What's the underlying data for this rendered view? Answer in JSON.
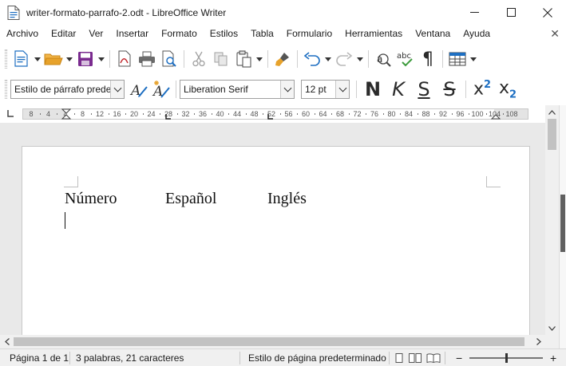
{
  "window": {
    "title": "writer-formato-parrafo-2.odt - LibreOffice Writer",
    "minimize_label": "—",
    "maximize_label": "☐",
    "close_label": "✕"
  },
  "menu": {
    "items": [
      "Archivo",
      "Editar",
      "Ver",
      "Insertar",
      "Formato",
      "Estilos",
      "Tabla",
      "Formulario",
      "Herramientas",
      "Ventana",
      "Ayuda"
    ],
    "close_doc": "✕"
  },
  "toolbar2": {
    "paragraph_style": "Estilo de párrafo predeterminado",
    "font_name": "Liberation Serif",
    "font_size": "12 pt",
    "bold_label": "N",
    "italic_label": "K",
    "underline_label": "S",
    "strike_label": "S",
    "superscript_base": "x",
    "superscript_mark": "2",
    "subscript_base": "x",
    "subscript_mark": "2",
    "spellcheck_label": "abc",
    "pilcrow": "¶"
  },
  "ruler": {
    "ticks": [
      "8",
      "4",
      "4",
      "8",
      "12",
      "16",
      "20",
      "24",
      "28",
      "32",
      "36",
      "40",
      "44",
      "48",
      "52",
      "56",
      "60",
      "64",
      "68",
      "72",
      "76",
      "80",
      "84",
      "88",
      "92",
      "96",
      "100",
      "104",
      "108"
    ]
  },
  "document": {
    "line1": [
      "Número",
      "Español",
      "Inglés"
    ]
  },
  "statusbar": {
    "page": "Página 1 de 1",
    "words": "3 palabras, 21 caracteres",
    "page_style": "Estilo de página predeterminado",
    "zoom_minus": "−",
    "zoom_plus": "+"
  },
  "colors": {
    "accent_blue": "#1e6fc2",
    "save_purple": "#7a2b8f",
    "open_orange": "#e7a22b",
    "spell_green": "#3c9b3c"
  }
}
